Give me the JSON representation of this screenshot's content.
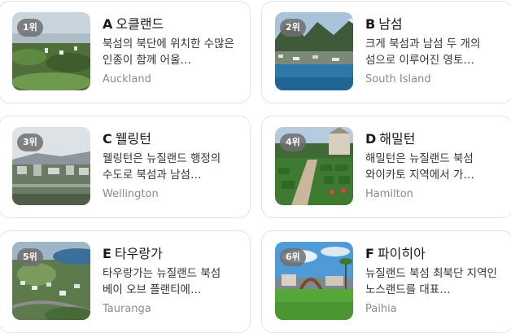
{
  "cards": [
    {
      "rank": "1위",
      "letter": "A",
      "name": "오클랜드",
      "desc": "북섬의 북단에 위치한 수많은 인종이 함께 어울…",
      "en": "Auckland"
    },
    {
      "rank": "2위",
      "letter": "B",
      "name": "남섬",
      "desc": "크게 북섬과 남섬 두 개의 섬으로 이루어진 영토…",
      "en": "South Island"
    },
    {
      "rank": "3위",
      "letter": "C",
      "name": "웰링턴",
      "desc": "웰링턴은 뉴질랜드 행정의 수도로 북섬과 남섬…",
      "en": "Wellington"
    },
    {
      "rank": "4위",
      "letter": "D",
      "name": "해밀턴",
      "desc": "해밀턴은 뉴질랜드 북섬 와이카토 지역에서 가…",
      "en": "Hamilton"
    },
    {
      "rank": "5위",
      "letter": "E",
      "name": "타우랑가",
      "desc": "타우랑가는 뉴질랜드 북섬 베이 오브 플랜티에…",
      "en": "Tauranga"
    },
    {
      "rank": "6위",
      "letter": "F",
      "name": "파이히아",
      "desc": "뉴질랜드 북섬 최북단 지역인 노스랜드를 대표…",
      "en": "Paihia"
    }
  ]
}
